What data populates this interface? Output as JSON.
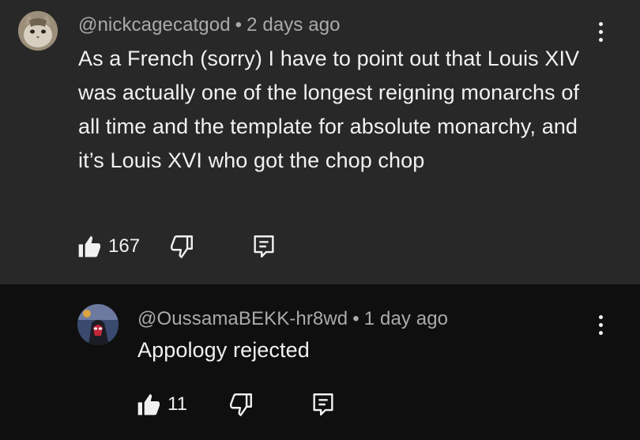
{
  "comments": [
    {
      "author": "@nickcagecatgod",
      "time": "2 days ago",
      "separator": "•",
      "text": "As a French (sorry) I have to point out that Louis XIV was actually one of the longest reigning monarchs of all time and the template for absolute monarchy, and it’s Louis XVI who got the chop chop",
      "likes": "167",
      "avatar_icon": "cat-avatar",
      "background": "#282828"
    },
    {
      "author": "@OussamaBEKK-hr8wd",
      "time": "1 day ago",
      "separator": "•",
      "text": "Appology rejected",
      "likes": "11",
      "avatar_icon": "spiderman-avatar",
      "background": "#0f0f0f"
    }
  ],
  "icons": {
    "like": "thumbs-up-icon",
    "dislike": "thumbs-down-icon",
    "reply": "reply-comment-icon",
    "more": "more-vertical-icon"
  },
  "colors": {
    "text_primary": "#f1f1f1",
    "text_secondary": "#aaaaaa"
  }
}
